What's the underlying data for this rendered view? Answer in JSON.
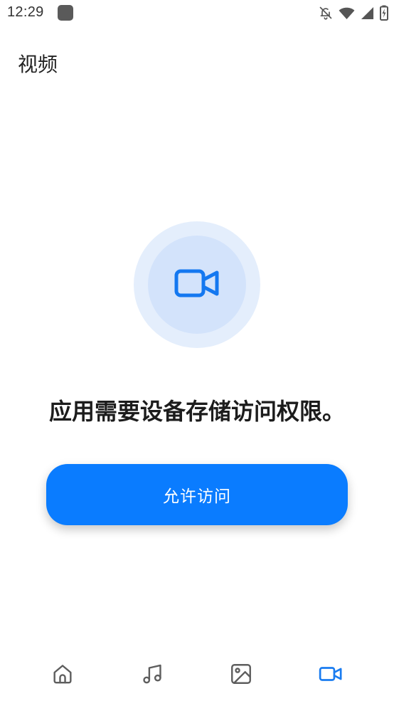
{
  "status_bar": {
    "time": "12:29",
    "icons": [
      "app-notification-icon",
      "bell-off-icon",
      "wifi-icon",
      "signal-icon",
      "battery-charging-icon"
    ]
  },
  "header": {
    "title": "视频"
  },
  "permission": {
    "icon": "video-camera-icon",
    "message": "应用需要设备存储访问权限。",
    "button_label": "允许访问"
  },
  "bottom_nav": {
    "items": [
      {
        "icon": "home-icon"
      },
      {
        "icon": "music-note-icon"
      },
      {
        "icon": "image-icon"
      },
      {
        "icon": "video-camera-icon"
      }
    ],
    "active_index": 3
  },
  "colors": {
    "accent": "#0a7cff",
    "icon_active": "#1a7cf0",
    "icon_inactive": "#5e5e5e",
    "circle_outer": "#e4eefc",
    "circle_inner": "#d3e3fb"
  }
}
